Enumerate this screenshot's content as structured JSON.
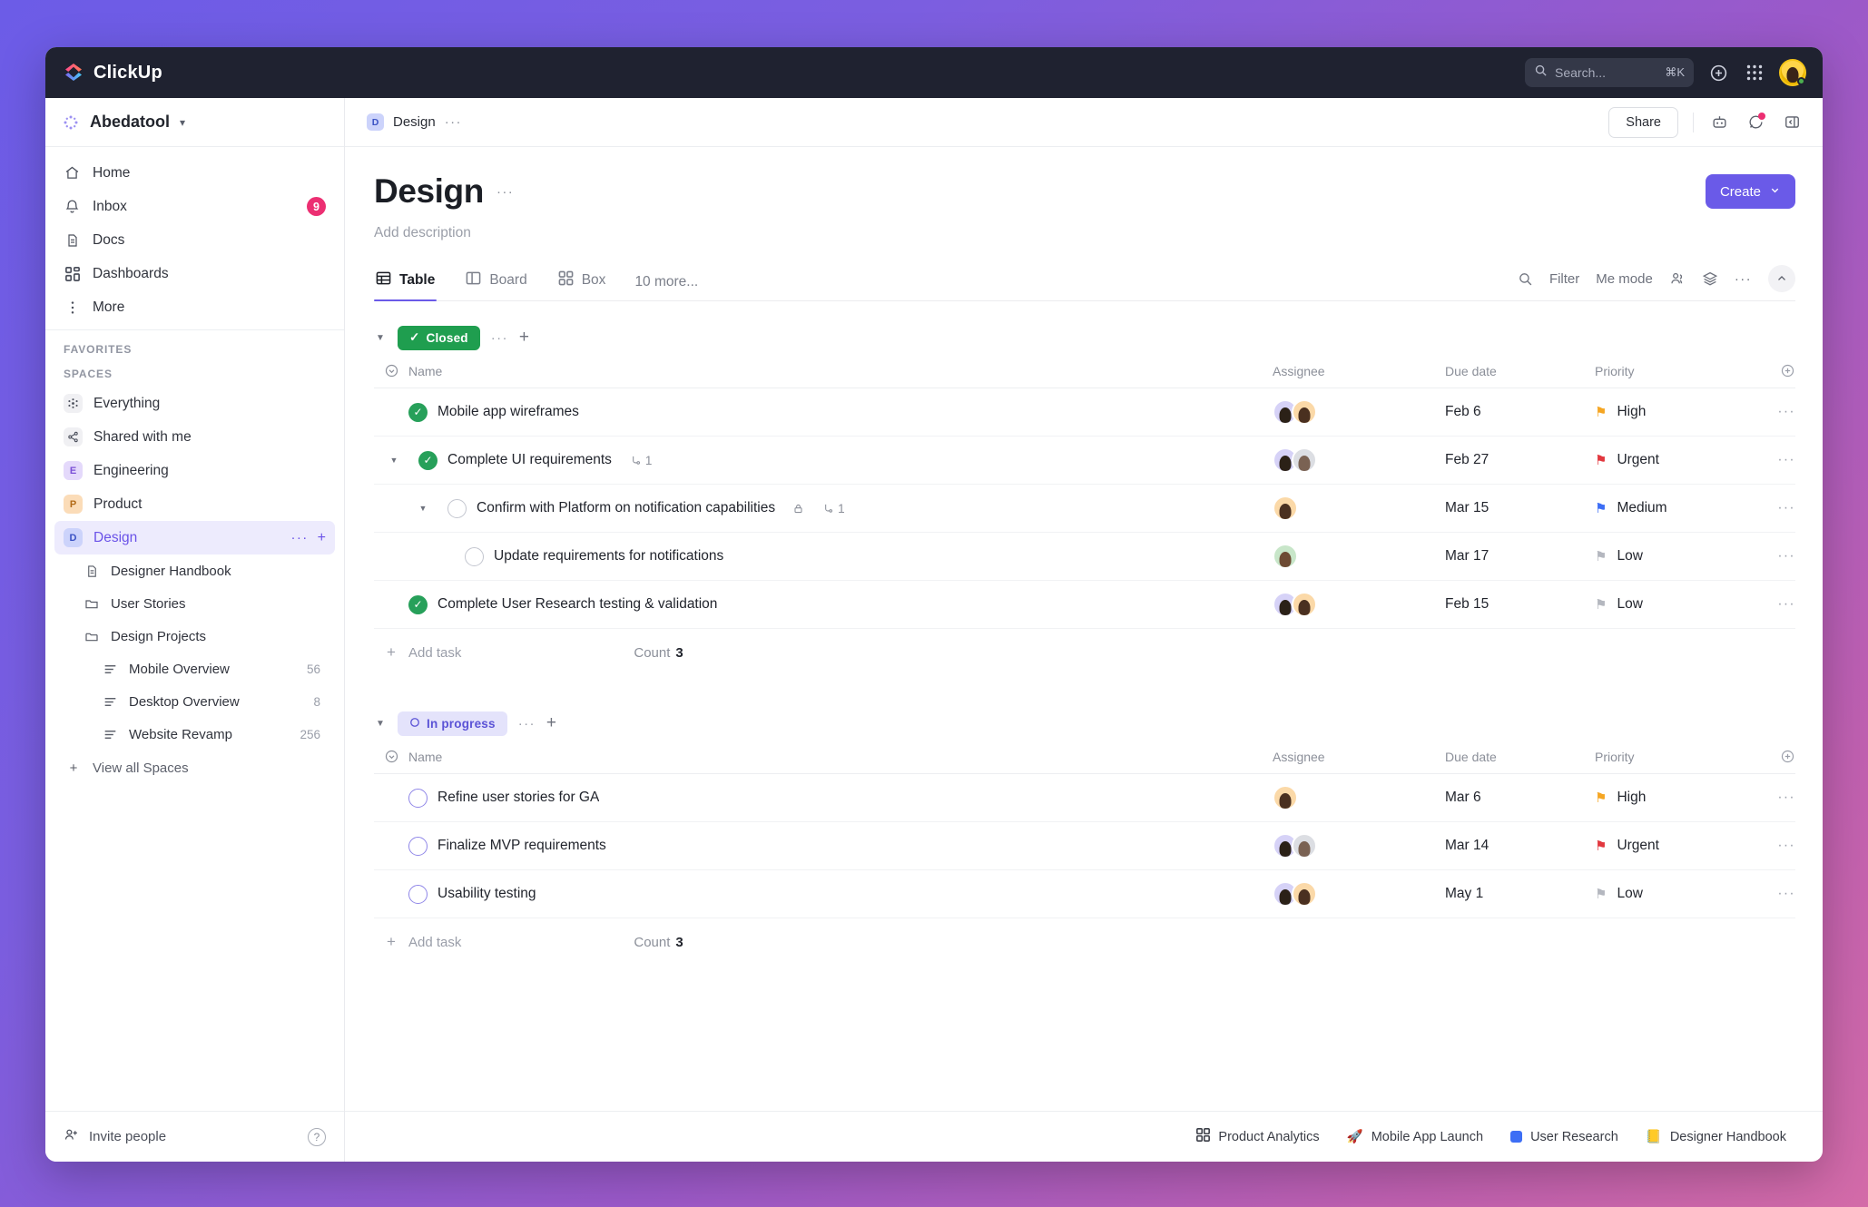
{
  "topbar": {
    "brand": "ClickUp",
    "search": {
      "placeholder": "Search...",
      "shortcut": "⌘K",
      "icon": "search-icon"
    },
    "icons": [
      "plus-circle-icon",
      "apps-grid-icon"
    ],
    "avatar": "user-avatar"
  },
  "sidebar": {
    "workspace": "Abedatool",
    "nav": [
      {
        "label": "Home",
        "icon": "home-icon"
      },
      {
        "label": "Inbox",
        "icon": "bell-icon",
        "badge": "9"
      },
      {
        "label": "Docs",
        "icon": "doc-icon"
      },
      {
        "label": "Dashboards",
        "icon": "dashboard-icon"
      },
      {
        "label": "More",
        "icon": "more-vertical-icon"
      }
    ],
    "favorites_label": "FAVORITES",
    "spaces_label": "SPACES",
    "spaces": [
      {
        "label": "Everything",
        "avatar": "*",
        "kind": "grey"
      },
      {
        "label": "Shared with me",
        "avatar": "<",
        "kind": "grey"
      },
      {
        "label": "Engineering",
        "avatar": "E",
        "kind": "purple"
      },
      {
        "label": "Product",
        "avatar": "P",
        "kind": "orange"
      },
      {
        "label": "Design",
        "avatar": "D",
        "kind": "blue",
        "active": true
      }
    ],
    "design_children": [
      {
        "label": "Designer Handbook",
        "icon": "doc-icon",
        "level": 1
      },
      {
        "label": "User Stories",
        "icon": "folder-icon",
        "level": 1
      },
      {
        "label": "Design Projects",
        "icon": "folder-open-icon",
        "level": 1
      },
      {
        "label": "Mobile Overview",
        "icon": "list-icon",
        "level": 2,
        "count": "56"
      },
      {
        "label": "Desktop Overview",
        "icon": "list-icon",
        "level": 2,
        "count": "8"
      },
      {
        "label": "Website Revamp",
        "icon": "list-icon",
        "level": 2,
        "count": "256"
      }
    ],
    "view_all": "View all Spaces",
    "invite": "Invite people",
    "help": "?"
  },
  "breadcrumb": {
    "avatar": "D",
    "label": "Design",
    "dots": "···"
  },
  "header_actions": {
    "share": "Share",
    "icons": [
      "robot-icon",
      "comment-icon",
      "panel-toggle-icon"
    ]
  },
  "page": {
    "title": "Design",
    "title_dots": "···",
    "description_placeholder": "Add description",
    "create_button": "Create"
  },
  "tabs": {
    "items": [
      {
        "label": "Table",
        "icon": "table-icon",
        "active": true
      },
      {
        "label": "Board",
        "icon": "board-icon",
        "active": false
      },
      {
        "label": "Box",
        "icon": "box-icon",
        "active": false
      }
    ],
    "more": "10 more...",
    "right": [
      {
        "label": "",
        "icon": "search-icon"
      },
      {
        "label": "Filter",
        "icon": ""
      },
      {
        "label": "Me mode",
        "icon": ""
      },
      {
        "label": "",
        "icon": "people-icon"
      },
      {
        "label": "",
        "icon": "layers-icon"
      },
      {
        "label": "···",
        "icon": ""
      }
    ],
    "collapse_icon": "chevron-up-icon"
  },
  "table": {
    "columns": [
      "Name",
      "Assignee",
      "Due date",
      "Priority"
    ],
    "add_task_label": "Add task",
    "count_label": "Count",
    "groups": [
      {
        "status": "Closed",
        "status_icon": "check-icon",
        "status_kind": "closed",
        "count": "3",
        "rows": [
          {
            "name": "Mobile app wireframes",
            "state": "done",
            "indent": 0,
            "expander": false,
            "avatars": [
              "p",
              "o"
            ],
            "due": "Feb 6",
            "priority": "High",
            "priority_kind": "high",
            "lock": false,
            "subtasks": ""
          },
          {
            "name": "Complete UI requirements",
            "state": "done",
            "indent": 0,
            "expander": true,
            "avatars": [
              "p",
              "s"
            ],
            "due": "Feb 27",
            "priority": "Urgent",
            "priority_kind": "urgent",
            "lock": false,
            "subtasks": "1"
          },
          {
            "name": "Confirm with Platform on notification capabilities",
            "state": "open",
            "indent": 1,
            "expander": true,
            "avatars": [
              "o"
            ],
            "due": "Mar 15",
            "priority": "Medium",
            "priority_kind": "medium",
            "lock": true,
            "subtasks": "1"
          },
          {
            "name": "Update requirements for notifications",
            "state": "open",
            "indent": 2,
            "expander": false,
            "avatars": [
              "g"
            ],
            "due": "Mar 17",
            "priority": "Low",
            "priority_kind": "low",
            "lock": false,
            "subtasks": ""
          },
          {
            "name": "Complete User Research testing & validation",
            "state": "done",
            "indent": 0,
            "expander": false,
            "avatars": [
              "p",
              "o"
            ],
            "due": "Feb 15",
            "priority": "Low",
            "priority_kind": "low",
            "lock": false,
            "subtasks": ""
          }
        ]
      },
      {
        "status": "In progress",
        "status_icon": "circle-icon",
        "status_kind": "inprog",
        "count": "3",
        "rows": [
          {
            "name": "Refine user stories for GA",
            "state": "prog",
            "indent": 0,
            "expander": false,
            "avatars": [
              "o"
            ],
            "due": "Mar 6",
            "priority": "High",
            "priority_kind": "high",
            "lock": false,
            "subtasks": ""
          },
          {
            "name": "Finalize MVP requirements",
            "state": "prog",
            "indent": 0,
            "expander": false,
            "avatars": [
              "p",
              "s"
            ],
            "due": "Mar 14",
            "priority": "Urgent",
            "priority_kind": "urgent",
            "lock": false,
            "subtasks": ""
          },
          {
            "name": "Usability testing",
            "state": "prog",
            "indent": 0,
            "expander": false,
            "avatars": [
              "p",
              "o"
            ],
            "due": "May 1",
            "priority": "Low",
            "priority_kind": "low",
            "lock": false,
            "subtasks": ""
          }
        ]
      }
    ]
  },
  "footer": {
    "items": [
      {
        "label": "Product Analytics",
        "icon": "dashboard-icon"
      },
      {
        "label": "Mobile App Launch",
        "icon": "rocket-icon"
      },
      {
        "label": "User Research",
        "icon": "blue-square-icon"
      },
      {
        "label": "Designer Handbook",
        "icon": "notebook-icon"
      }
    ]
  },
  "colors": {
    "accent": "#6a5ae8",
    "closed_green": "#1f9e4f",
    "urgent": "#e2383f",
    "high": "#f5a623",
    "medium": "#3d6ef5",
    "low": "#b4b7bf",
    "badge_pink": "#ec2f72"
  }
}
